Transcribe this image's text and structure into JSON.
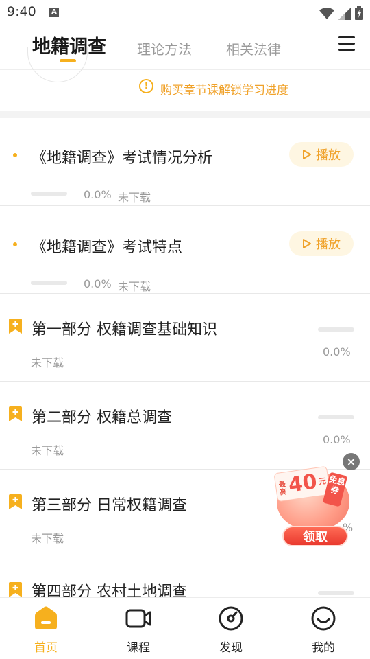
{
  "status_bar": {
    "time": "9:40",
    "notification_icon": "A"
  },
  "top_nav": {
    "tabs": [
      {
        "label": "地籍调查",
        "active": true
      },
      {
        "label": "理论方法",
        "active": false
      },
      {
        "label": "相关法律",
        "active": false
      }
    ],
    "menu_icon": "menu-icon"
  },
  "notice": {
    "icon": "warning-circle-icon",
    "text": "购买章节课解锁学习进度"
  },
  "lessons": [
    {
      "title": "《地籍调查》考试情况分析",
      "play_label": "播放",
      "progress_text": "0.0%",
      "progress": 0.0,
      "download_status": "未下载"
    },
    {
      "title": "《地籍调查》考试特点",
      "play_label": "播放",
      "progress_text": "0.0%",
      "progress": 0.0,
      "download_status": "未下载"
    }
  ],
  "chapters": [
    {
      "title": "第一部分 权籍调查基础知识",
      "download_status": "未下载",
      "progress_text": "0.0%",
      "progress": 0.0
    },
    {
      "title": "第二部分 权籍总调查",
      "download_status": "未下载",
      "progress_text": "0.0%",
      "progress": 0.0
    },
    {
      "title": "第三部分 日常权籍调查",
      "download_status": "未下载",
      "progress_text": "%",
      "progress": 0.0
    },
    {
      "title": "第四部分 农村土地调查",
      "download_status": "",
      "progress_text": "",
      "progress": 0.0
    }
  ],
  "coupon": {
    "label_top": "最高",
    "amount": "40",
    "unit": "元",
    "tag": "免息券",
    "button": "领取",
    "close": "×"
  },
  "bottom_nav": [
    {
      "label": "首页",
      "icon": "home-icon",
      "active": true
    },
    {
      "label": "课程",
      "icon": "video-camera-icon",
      "active": false
    },
    {
      "label": "发现",
      "icon": "compass-icon",
      "active": false
    },
    {
      "label": "我的",
      "icon": "smiley-face-icon",
      "active": false
    }
  ],
  "colors": {
    "accent": "#f6b01e",
    "accent_text": "#f0a22a",
    "muted": "#9a9a9a"
  }
}
